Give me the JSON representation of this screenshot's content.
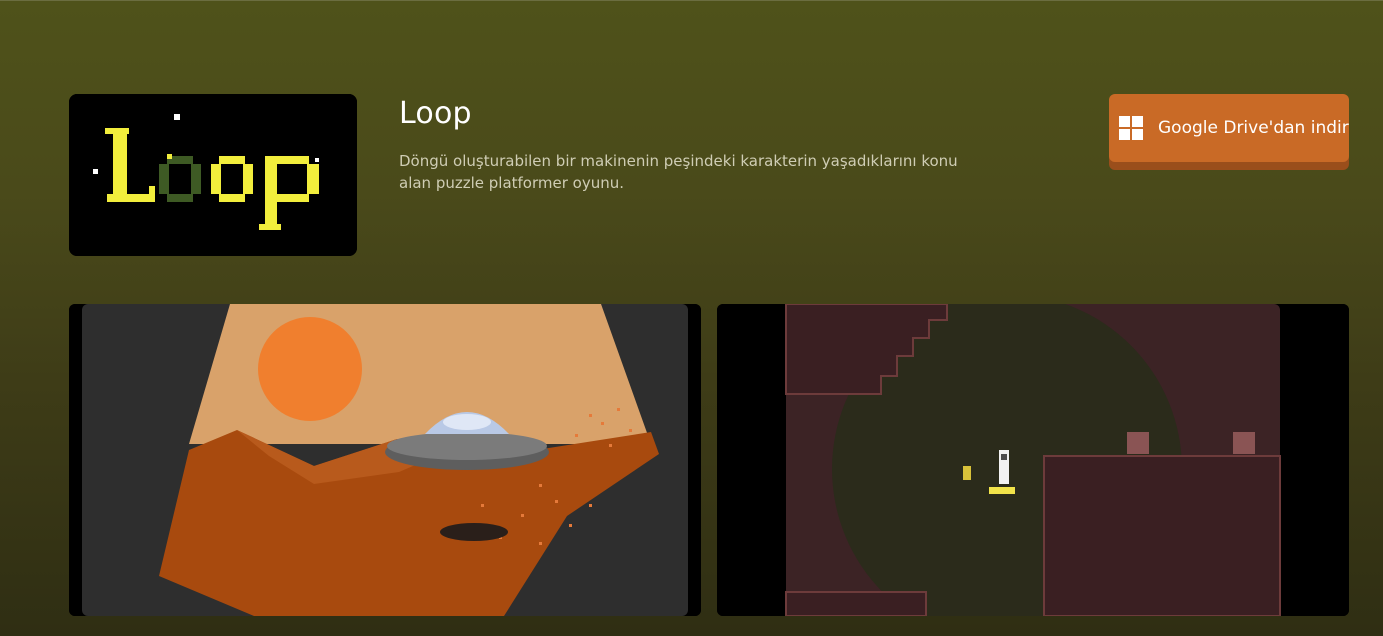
{
  "game": {
    "title": "Loop",
    "description": "Döngü oluşturabilen bir makinenin peşindeki karakterin yaşadıklarını konu alan puzzle platformer oyunu.",
    "logo_text": "Loop"
  },
  "download": {
    "label": "Google Drive'dan indir",
    "icon": "windows-icon"
  },
  "screenshots": [
    {
      "name": "desert-ufo-scene"
    },
    {
      "name": "cave-platform-scene"
    }
  ],
  "colors": {
    "accent": "#c96a26",
    "logo_yellow": "#f2ee3c",
    "logo_green": "#3e5a24"
  }
}
